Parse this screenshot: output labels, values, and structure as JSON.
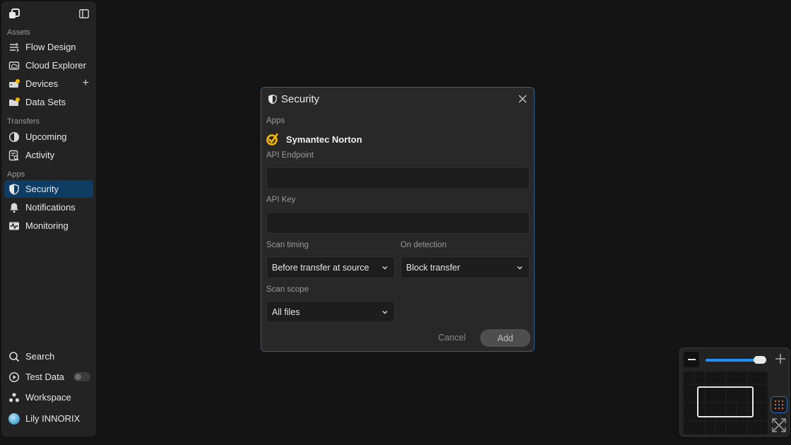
{
  "sidebar": {
    "sections": {
      "assets": "Assets",
      "transfers": "Transfers",
      "apps": "Apps"
    },
    "items": {
      "flow_design": "Flow Design",
      "cloud_explorer": "Cloud Explorer",
      "devices": "Devices",
      "data_sets": "Data Sets",
      "upcoming": "Upcoming",
      "activity": "Activity",
      "security": "Security",
      "notifications": "Notifications",
      "monitoring": "Monitoring"
    },
    "bottom": {
      "search": "Search",
      "test_data": "Test Data",
      "test_data_enabled": false,
      "workspace": "Workspace",
      "user": "Lily INNORIX"
    },
    "active_item": "security"
  },
  "modal": {
    "title": "Security",
    "apps_label": "Apps",
    "app_name": "Symantec Norton",
    "api_endpoint_label": "API Endpoint",
    "api_endpoint_value": "",
    "api_key_label": "API Key",
    "api_key_value": "",
    "scan_timing_label": "Scan timing",
    "scan_timing_value": "Before transfer at source",
    "on_detection_label": "On detection",
    "on_detection_value": "Block transfer",
    "scan_scope_label": "Scan scope",
    "scan_scope_value": "All files",
    "cancel_label": "Cancel",
    "add_label": "Add"
  },
  "minimap": {
    "zoom_level": 0.9
  },
  "colors": {
    "background": "#141414",
    "sidebar": "#232323",
    "active_item": "#0f3c63",
    "accent": "#1e90ff",
    "modal_border": "#2a5f8a",
    "norton_yellow": "#f5b800"
  }
}
